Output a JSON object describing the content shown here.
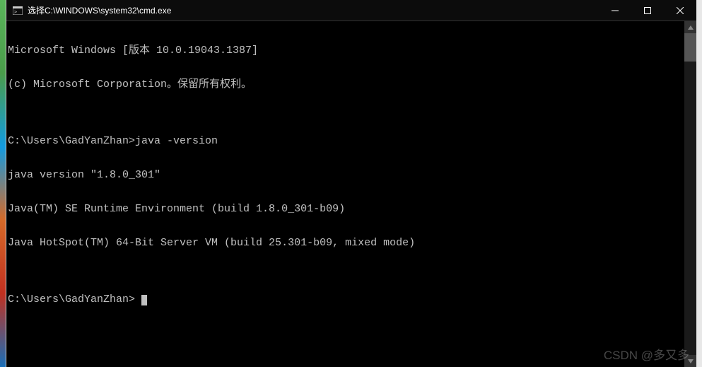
{
  "window": {
    "title": "选择C:\\WINDOWS\\system32\\cmd.exe"
  },
  "terminal": {
    "lines": [
      "Microsoft Windows [版本 10.0.19043.1387]",
      "(c) Microsoft Corporation。保留所有权利。",
      "",
      "C:\\Users\\GadYanZhan>java -version",
      "java version \"1.8.0_301\"",
      "Java(TM) SE Runtime Environment (build 1.8.0_301-b09)",
      "Java HotSpot(TM) 64-Bit Server VM (build 25.301-b09, mixed mode)",
      "",
      "C:\\Users\\GadYanZhan> "
    ]
  },
  "watermark": "CSDN @多又多"
}
